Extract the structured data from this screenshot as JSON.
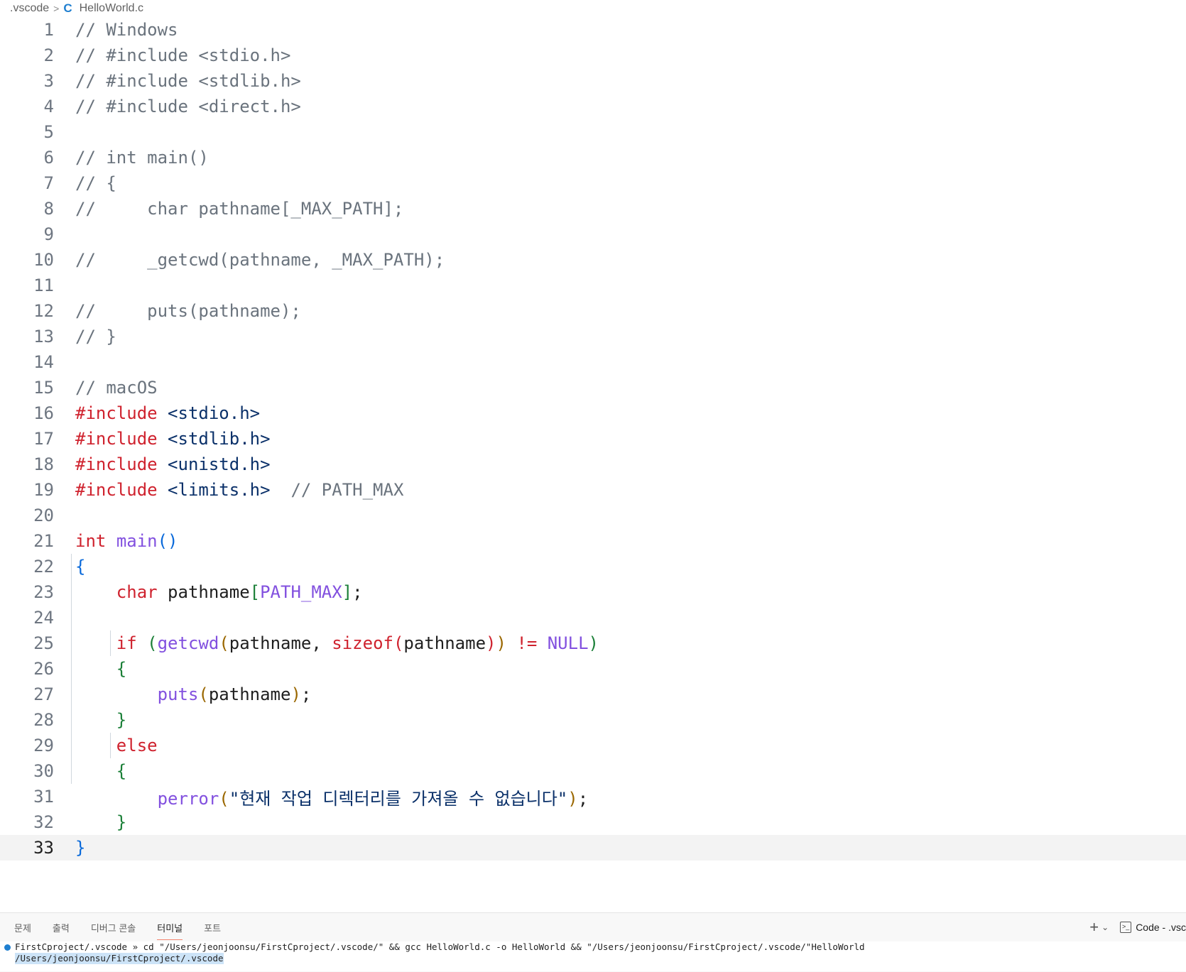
{
  "breadcrumb": {
    "folder": ".vscode",
    "file": "HelloWorld.c",
    "separator": ">",
    "file_icon": "c-language-icon"
  },
  "editor": {
    "current_line": 33,
    "lines": [
      {
        "n": "1"
      },
      {
        "n": "2"
      },
      {
        "n": "3"
      },
      {
        "n": "4"
      },
      {
        "n": "5"
      },
      {
        "n": "6"
      },
      {
        "n": "7"
      },
      {
        "n": "8"
      },
      {
        "n": "9"
      },
      {
        "n": "10"
      },
      {
        "n": "11"
      },
      {
        "n": "12"
      },
      {
        "n": "13"
      },
      {
        "n": "14"
      },
      {
        "n": "15"
      },
      {
        "n": "16"
      },
      {
        "n": "17"
      },
      {
        "n": "18"
      },
      {
        "n": "19"
      },
      {
        "n": "20"
      },
      {
        "n": "21"
      },
      {
        "n": "22"
      },
      {
        "n": "23"
      },
      {
        "n": "24"
      },
      {
        "n": "25"
      },
      {
        "n": "26"
      },
      {
        "n": "27"
      },
      {
        "n": "28"
      },
      {
        "n": "29"
      },
      {
        "n": "30"
      },
      {
        "n": "31"
      },
      {
        "n": "32"
      },
      {
        "n": "33"
      }
    ],
    "code": {
      "l1": "// Windows",
      "l2": "// #include <stdio.h>",
      "l3": "// #include <stdlib.h>",
      "l4": "// #include <direct.h>",
      "l6": "// int main()",
      "l7": "// {",
      "l8": "//     char pathname[_MAX_PATH];",
      "l10": "//     _getcwd(pathname, _MAX_PATH);",
      "l12": "//     puts(pathname);",
      "l13": "// }",
      "l15": "// macOS",
      "inc": "#include",
      "l16h": "<stdio.h>",
      "l17h": "<stdlib.h>",
      "l18h": "<unistd.h>",
      "l19h": "<limits.h>",
      "l19c": "// PATH_MAX",
      "int": "int",
      "main": "main",
      "char": "char",
      "pathname": "pathname",
      "PATH_MAX": "PATH_MAX",
      "if": "if",
      "getcwd": "getcwd",
      "sizeof": "sizeof",
      "neq": "!=",
      "NULL": "NULL",
      "puts": "puts",
      "else": "else",
      "perror": "perror",
      "msg": "\"현재 작업 디렉터리를 가져올 수 없습니다\""
    }
  },
  "panel": {
    "tabs": [
      "문제",
      "출력",
      "디버그 콘솔",
      "터미널",
      "포트"
    ],
    "active_tab": "터미널",
    "terminal_name": "Code - .vsc",
    "terminal": {
      "line1": "FirstCproject/.vscode » cd \"/Users/jeonjoonsu/FirstCproject/.vscode/\" && gcc HelloWorld.c -o HelloWorld && \"/Users/jeonjoonsu/FirstCproject/.vscode/\"HelloWorld",
      "line2": "/Users/jeonjoonsu/FirstCproject/.vscode"
    }
  },
  "colors": {
    "accent": "#1f7fd0",
    "keyword": "#cf222e",
    "function": "#8250df",
    "comment": "#6a737d"
  }
}
